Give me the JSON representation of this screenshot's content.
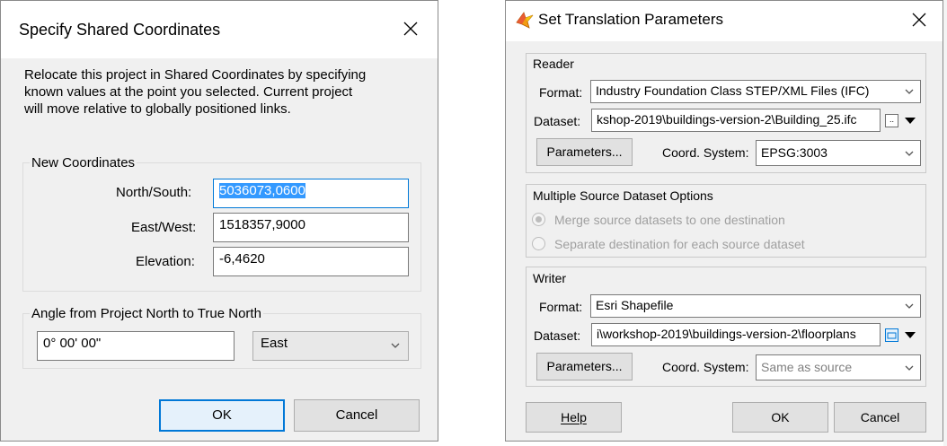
{
  "dialog1": {
    "title": "Specify Shared Coordinates",
    "description": [
      "Relocate this project in Shared Coordinates by specifying",
      "known values at the point you selected. Current project",
      "will move relative to globally positioned links."
    ],
    "new_coordinates": {
      "group_label": "New Coordinates",
      "north_south_label": "North/South:",
      "north_south_value": "5036073,0600",
      "east_west_label": "East/West:",
      "east_west_value": "1518357,9000",
      "elevation_label": "Elevation:",
      "elevation_value": "-6,4620"
    },
    "angle": {
      "group_label": "Angle from Project North to True North",
      "value": "0° 00' 00\"",
      "direction": "East"
    },
    "ok_label": "OK",
    "cancel_label": "Cancel"
  },
  "dialog2": {
    "title": "Set Translation Parameters",
    "reader": {
      "section_label": "Reader",
      "format_label": "Format:",
      "format_value": "Industry Foundation Class STEP/XML Files (IFC)",
      "dataset_label": "Dataset:",
      "dataset_value": "kshop-2019\\buildings-version-2\\Building_25.ifc",
      "dataset_browse": "..",
      "parameters_label": "Parameters...",
      "coord_label": "Coord. System:",
      "coord_value": "EPSG:3003"
    },
    "multi": {
      "section_label": "Multiple Source Dataset Options",
      "option1": "Merge source datasets to one destination",
      "option2": "Separate destination for each source dataset"
    },
    "writer": {
      "section_label": "Writer",
      "format_label": "Format:",
      "format_value": "Esri Shapefile",
      "dataset_label": "Dataset:",
      "dataset_value": "i\\workshop-2019\\buildings-version-2\\floorplans",
      "parameters_label": "Parameters...",
      "coord_label": "Coord. System:",
      "coord_value": "Same as source"
    },
    "help_label": "Help",
    "ok_label": "OK",
    "cancel_label": "Cancel"
  },
  "colors": {
    "accent": "#0078d7",
    "selection": "#3399ff",
    "dialog_bg": "#f0f0f0"
  }
}
